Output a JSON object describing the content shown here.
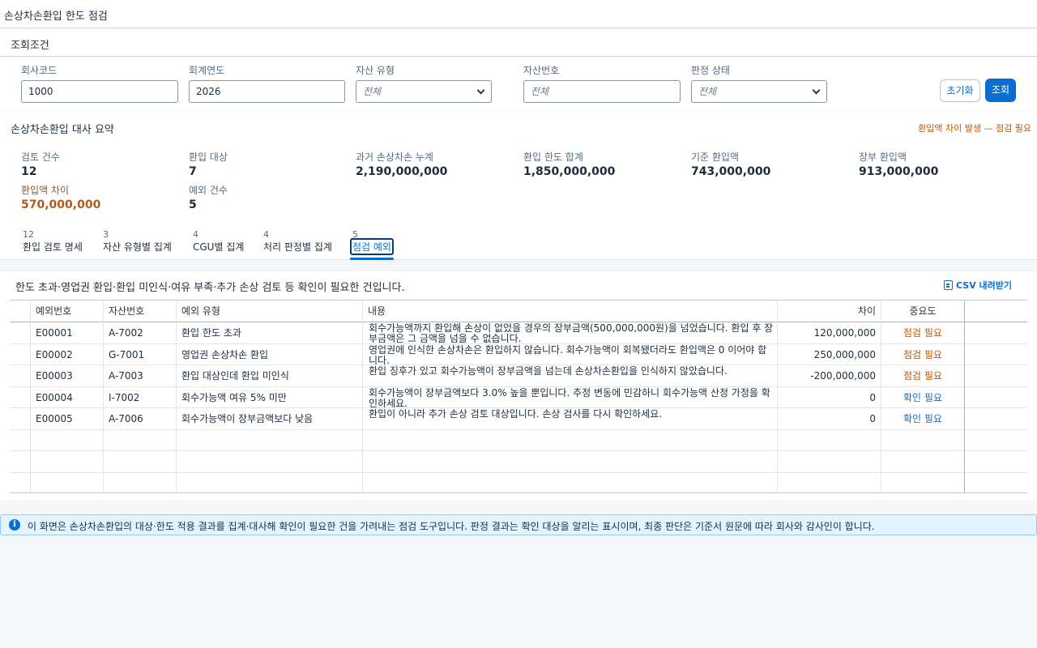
{
  "app": {
    "title": "손상차손환입 한도 점검"
  },
  "conditions": {
    "header": "조회조건",
    "company": {
      "label": "회사코드",
      "value": "1000"
    },
    "fiscal_year": {
      "label": "회계연도",
      "value": "2026"
    },
    "asset_type": {
      "label": "자산 유형",
      "value": "전체"
    },
    "asset_no": {
      "label": "자산번호",
      "placeholder": "전체"
    },
    "status": {
      "label": "판정 상태",
      "value": "전체"
    },
    "reset_label": "초기화",
    "search_label": "조회"
  },
  "summary": {
    "header": "손상차손환입 대사 요약",
    "warning": "환입액 차이 발생 — 점검 필요",
    "kpis": [
      {
        "label": "검토 건수",
        "value": "12"
      },
      {
        "label": "환입 대상",
        "value": "7"
      },
      {
        "label": "과거 손상차손 누계",
        "value": "2,190,000,000"
      },
      {
        "label": "환입 한도 합계",
        "value": "1,850,000,000"
      },
      {
        "label": "기준 환입액",
        "value": "743,000,000"
      },
      {
        "label": "장부 환입액",
        "value": "913,000,000"
      },
      {
        "label": "환입액 차이",
        "value": "570,000,000"
      },
      {
        "label": "예외 건수",
        "value": "5"
      }
    ]
  },
  "tabs": [
    {
      "count": "12",
      "label": "환입 검토 명세"
    },
    {
      "count": "3",
      "label": "자산 유형별 집계"
    },
    {
      "count": "4",
      "label": "CGU별 집계"
    },
    {
      "count": "4",
      "label": "처리 판정별 집계"
    },
    {
      "count": "5",
      "label": "점검 예외"
    }
  ],
  "exceptions": {
    "intro": "한도 초과·영업권 환입·환입 미인식·여유 부족·추가 손상 검토 등 확인이 필요한 건입니다.",
    "csv_label": "CSV 내려받기",
    "columns": [
      "예외번호",
      "자산번호",
      "예외 유형",
      "내용",
      "차이",
      "중요도"
    ],
    "rows": [
      {
        "id": "E00001",
        "asset": "A-7002",
        "type": "환입 한도 초과",
        "desc": "회수가능액까지 환입해 손상이 없었을 경우의 장부금액(500,000,000원)을 넘었습니다. 환입 후 장부금액은 그 금액을 넘을 수 없습니다.",
        "diff": "120,000,000",
        "sev": "점검 필요",
        "sev_kind": "warn"
      },
      {
        "id": "E00002",
        "asset": "G-7001",
        "type": "영업권 손상차손 환입",
        "desc": "영업권에 인식한 손상차손은 환입하지 않습니다. 회수가능액이 회복됐더라도 환입액은 0 이어야 합니다.",
        "diff": "250,000,000",
        "sev": "점검 필요",
        "sev_kind": "warn"
      },
      {
        "id": "E00003",
        "asset": "A-7003",
        "type": "환입 대상인데 환입 미인식",
        "desc": "환입 징후가 있고 회수가능액이 장부금액을 넘는데 손상차손환입을 인식하지 않았습니다.",
        "diff": "-200,000,000",
        "sev": "점검 필요",
        "sev_kind": "warn"
      },
      {
        "id": "E00004",
        "asset": "I-7002",
        "type": "회수가능액 여유 5% 미만",
        "desc": "회수가능액이 장부금액보다 3.0% 높을 뿐입니다. 추정 변동에 민감하니 회수가능액 산정 가정을 확인하세요.",
        "diff": "0",
        "sev": "확인 필요",
        "sev_kind": "info"
      },
      {
        "id": "E00005",
        "asset": "A-7006",
        "type": "회수가능액이 장부금액보다 낮음",
        "desc": "환입이 아니라 추가 손상 검토 대상입니다. 손상 검사를 다시 확인하세요.",
        "diff": "0",
        "sev": "확인 필요",
        "sev_kind": "info"
      }
    ]
  },
  "info": {
    "text": "이 화면은 손상차손환입의 대상·한도 적용 결과를 집계·대사해 확인이 필요한 건을 가려내는 점검 도구입니다. 판정 결과는 확인 대상을 알리는 표시이며, 최종 판단은 기준서 원문에 따라 회사와 감사인이 합니다."
  },
  "colors": {
    "accent": "#0a6ed1",
    "warn": "#c35500",
    "alert_value": "#b1581b"
  }
}
